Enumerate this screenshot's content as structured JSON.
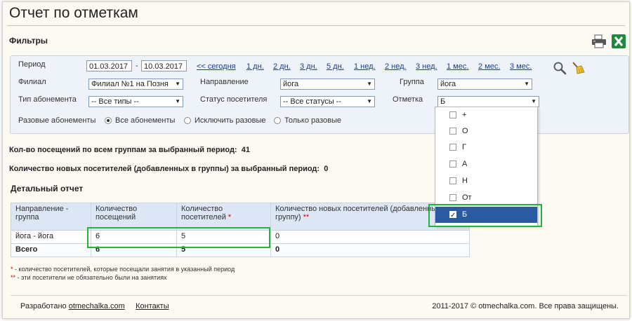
{
  "page": {
    "title": "Отчет по отметкам"
  },
  "filters": {
    "heading": "Фильтры",
    "period_label": "Период",
    "date_from": "01.03.2017",
    "date_sep": "-",
    "date_to": "10.03.2017",
    "quick_links": [
      "<< сегодня",
      "1 дн.",
      "2 дн.",
      "3 дн.",
      "5 дн.",
      "1 нед.",
      "2 нед.",
      "3 нед.",
      "1 мес.",
      "2 мес.",
      "3 мес."
    ],
    "branch_label": "Филиал",
    "branch_value": "Филиал №1 на Позня",
    "direction_label": "Направление",
    "direction_value": "йога",
    "group_label": "Группа",
    "group_value": "йога",
    "sub_type_label": "Тип абонемента",
    "sub_type_value": "-- Все типы --",
    "visitor_status_label": "Статус посетителя",
    "visitor_status_value": "-- Все статусы --",
    "mark_label": "Отметка",
    "mark_value": "Б",
    "one_time_label": "Разовые абонементы",
    "one_time_options": [
      {
        "label": "Все абонементы",
        "selected": true
      },
      {
        "label": "Исключить разовые",
        "selected": false
      },
      {
        "label": "Только разовые",
        "selected": false
      }
    ]
  },
  "mark_dropdown": {
    "items": [
      {
        "label": "+",
        "checked": false
      },
      {
        "label": "О",
        "checked": false
      },
      {
        "label": "Г",
        "checked": false
      },
      {
        "label": "А",
        "checked": false
      },
      {
        "label": "Н",
        "checked": false
      },
      {
        "label": "От",
        "checked": false
      },
      {
        "label": "Б",
        "checked": true
      }
    ]
  },
  "stats": {
    "visits_label": "Кол-во посещений по всем группам за выбранный период:",
    "visits_value": "41",
    "new_label": "Количество новых посетителей (добавленных в группы) за выбранный период:",
    "new_value": "0"
  },
  "report": {
    "heading": "Детальный отчет",
    "headers": {
      "direction_group": "Направление - группа",
      "visits": "Количество посещений",
      "visitors": "Количество посетителей",
      "new_visitors": "Количество новых посетителей (добавленных в группу)"
    },
    "rows": [
      {
        "name": "йога - йога",
        "visits": "6",
        "visitors": "5",
        "new": "0"
      }
    ],
    "total": {
      "name": "Всего",
      "visits": "6",
      "visitors": "5",
      "new": "0"
    },
    "note1": "- количество посетителей, которые посещали занятия в указанный период",
    "note2": "- эти посетители не обязательно были на занятиях"
  },
  "footer": {
    "developed_by": "Разработано",
    "site_link": "otmechalka.com",
    "contacts_link": "Контакты",
    "copyright": "2011-2017 © otmechalka.com. Все права защищены."
  },
  "colors": {
    "highlight": "#23b33a",
    "selected": "#2c5aa0",
    "link": "#1a3c8c"
  }
}
